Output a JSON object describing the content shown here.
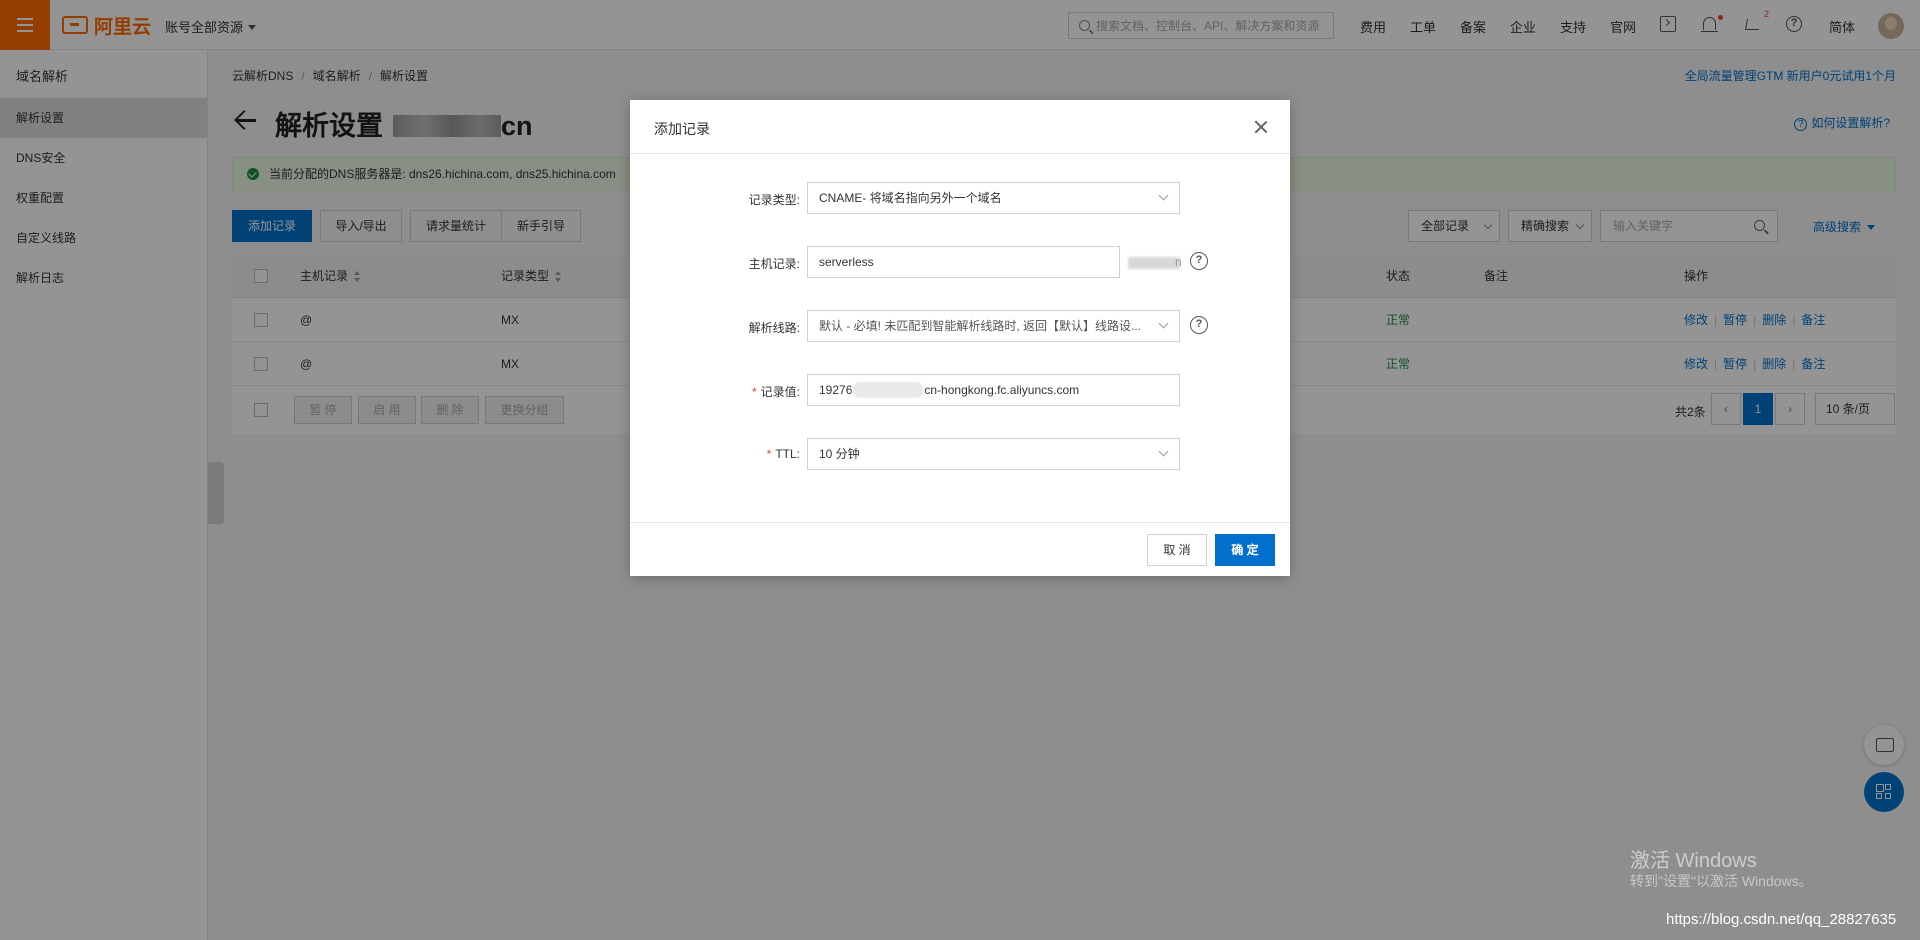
{
  "topbar": {
    "brand": "阿里云",
    "account": "账号全部资源",
    "search_placeholder": "搜索文档、控制台、API、解决方案和资源",
    "nav": [
      "费用",
      "工单",
      "备案",
      "企业",
      "支持",
      "官网"
    ],
    "cart_count": "2",
    "lang": "简体"
  },
  "sidebar": {
    "title": "域名解析",
    "items": [
      "解析设置",
      "DNS安全",
      "权重配置",
      "自定义线路",
      "解析日志"
    ]
  },
  "breadcrumb": [
    "云解析DNS",
    "域名解析",
    "解析设置"
  ],
  "promo": "全局流量管理GTM 新用户0元试用1个月",
  "page": {
    "title": "解析设置",
    "domain_suffix": "cn",
    "howto": "如何设置解析?",
    "notice": "当前分配的DNS服务器是: dns26.hichina.com, dns25.hichina.com"
  },
  "toolbar": {
    "add": "添加记录",
    "import": "导入/导出",
    "stats": "请求量统计",
    "guide": "新手引导",
    "filter": "全部记录",
    "search_mode": "精确搜索",
    "keyword_placeholder": "输入关键字",
    "advanced": "高级搜索"
  },
  "table": {
    "headers": {
      "host": "主机记录",
      "type": "记录类型",
      "status": "状态",
      "remark": "备注",
      "ops": "操作"
    },
    "rows": [
      {
        "host": "@",
        "type": "MX",
        "status": "正常"
      },
      {
        "host": "@",
        "type": "MX",
        "status": "正常"
      }
    ],
    "ops": [
      "修改",
      "暂停",
      "删除",
      "备注"
    ],
    "bulk": [
      "暂 停",
      "启 用",
      "删 除",
      "更换分组"
    ],
    "total": "共2条",
    "page": "1",
    "page_size": "10 条/页"
  },
  "modal": {
    "title": "添加记录",
    "fields": {
      "type_label": "记录类型:",
      "type_value": "CNAME- 将域名指向另外一个域名",
      "host_label": "主机记录:",
      "host_value": "serverless",
      "host_suffix": "n",
      "line_label": "解析线路:",
      "line_value": "默认 - 必填! 未匹配到智能解析线路时, 返回【默认】线路设...",
      "value_label": "记录值:",
      "value_prefix": "19276",
      "value_suffix": "cn-hongkong.fc.aliyuncs.com",
      "ttl_label": "TTL:",
      "ttl_value": "10 分钟"
    },
    "cancel": "取 消",
    "confirm": "确 定"
  },
  "watermark": {
    "line1": "激活 Windows",
    "line2": "转到\"设置\"以激活 Windows。",
    "csdn": "https://blog.csdn.net/qq_28827635"
  }
}
